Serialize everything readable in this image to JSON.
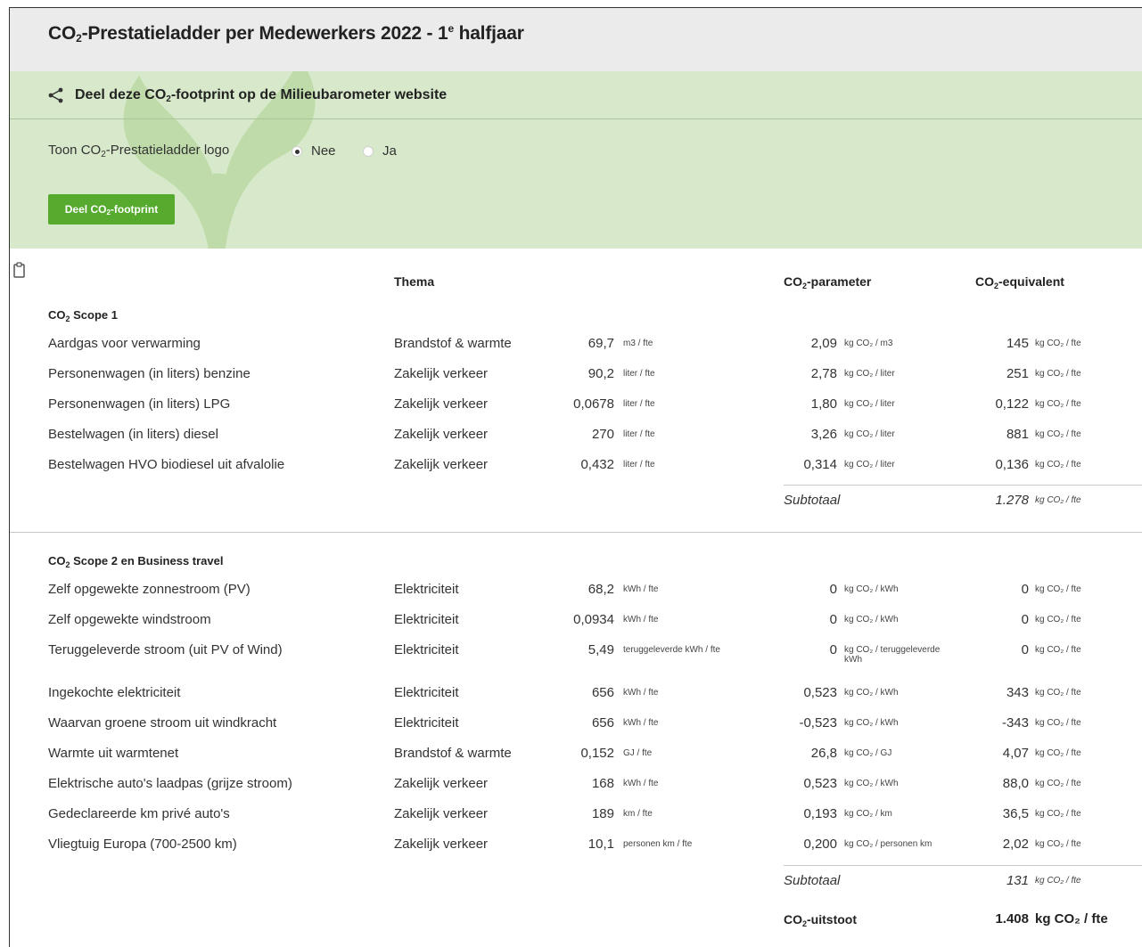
{
  "page": {
    "title_prefix": "CO",
    "title_sub": "2",
    "title_middle": "-Prestatieladder per Medewerkers 2022 - 1",
    "title_sup": "e",
    "title_suffix": " halfjaar"
  },
  "share": {
    "title_prefix": "Deel deze CO",
    "title_sub": "2",
    "title_suffix": "-footprint op de Milieubarometer website",
    "logo_label_prefix": "Toon CO",
    "logo_label_sub": "2",
    "logo_label_suffix": "-Prestatieladder logo",
    "option_no": "Nee",
    "option_yes": "Ja",
    "selected": "Nee",
    "button_prefix": "Deel CO",
    "button_sub": "2",
    "button_suffix": "-footprint",
    "button_color": "#56ab2f",
    "panel_color": "#d7e9ca"
  },
  "table": {
    "col_theme": "Thema",
    "col_param_prefix": "CO",
    "col_param_sub": "2",
    "col_param_suffix": "-parameter",
    "col_eq_prefix": "CO",
    "col_eq_sub": "2",
    "col_eq_suffix": "-equivalent"
  },
  "scope1": {
    "title_prefix": "CO",
    "title_sub": "2",
    "title_suffix": " Scope 1",
    "rows": [
      {
        "name": "Aardgas voor verwarming",
        "theme": "Brandstof & warmte",
        "amount": "69,7",
        "amount_unit": "m3 / fte",
        "param": "2,09",
        "param_unit": "kg CO₂ / m3",
        "eq": "145",
        "eq_unit": "kg CO₂ / fte"
      },
      {
        "name": "Personenwagen (in liters) benzine",
        "theme": "Zakelijk verkeer",
        "amount": "90,2",
        "amount_unit": "liter / fte",
        "param": "2,78",
        "param_unit": "kg CO₂ / liter",
        "eq": "251",
        "eq_unit": "kg CO₂ / fte"
      },
      {
        "name": "Personenwagen (in liters) LPG",
        "theme": "Zakelijk verkeer",
        "amount": "0,0678",
        "amount_unit": "liter / fte",
        "param": "1,80",
        "param_unit": "kg CO₂ / liter",
        "eq": "0,122",
        "eq_unit": "kg CO₂ / fte"
      },
      {
        "name": "Bestelwagen (in liters) diesel",
        "theme": "Zakelijk verkeer",
        "amount": "270",
        "amount_unit": "liter / fte",
        "param": "3,26",
        "param_unit": "kg CO₂ / liter",
        "eq": "881",
        "eq_unit": "kg CO₂ / fte"
      },
      {
        "name": "Bestelwagen HVO biodiesel uit afvalolie",
        "theme": "Zakelijk verkeer",
        "amount": "0,432",
        "amount_unit": "liter / fte",
        "param": "0,314",
        "param_unit": "kg CO₂ / liter",
        "eq": "0,136",
        "eq_unit": "kg CO₂ / fte"
      }
    ],
    "subtotal_label": "Subtotaal",
    "subtotal_value": "1.278",
    "subtotal_unit": "kg CO₂ / fte"
  },
  "scope2": {
    "title_prefix": "CO",
    "title_sub": "2",
    "title_suffix": " Scope 2 en Business travel",
    "rows": [
      {
        "name": "Zelf opgewekte zonnestroom (PV)",
        "theme": "Elektriciteit",
        "amount": "68,2",
        "amount_unit": "kWh / fte",
        "param": "0",
        "param_unit": "kg CO₂ / kWh",
        "eq": "0",
        "eq_unit": "kg CO₂ / fte"
      },
      {
        "name": "Zelf opgewekte windstroom",
        "theme": "Elektriciteit",
        "amount": "0,0934",
        "amount_unit": "kWh / fte",
        "param": "0",
        "param_unit": "kg CO₂ / kWh",
        "eq": "0",
        "eq_unit": "kg CO₂ / fte"
      },
      {
        "name": "Teruggeleverde stroom (uit PV of Wind)",
        "theme": "Elektriciteit",
        "amount": "5,49",
        "amount_unit": "teruggeleverde kWh / fte",
        "param": "0",
        "param_unit": "kg CO₂ / teruggeleverde kWh",
        "eq": "0",
        "eq_unit": "kg CO₂ / fte"
      },
      {
        "name": "Ingekochte elektriciteit",
        "theme": "Elektriciteit",
        "amount": "656",
        "amount_unit": "kWh / fte",
        "param": "0,523",
        "param_unit": "kg CO₂ / kWh",
        "eq": "343",
        "eq_unit": "kg CO₂ / fte"
      },
      {
        "name": "Waarvan groene stroom uit windkracht",
        "theme": "Elektriciteit",
        "amount": "656",
        "amount_unit": "kWh / fte",
        "param": "-0,523",
        "param_unit": "kg CO₂ / kWh",
        "eq": "-343",
        "eq_unit": "kg CO₂ / fte"
      },
      {
        "name": "Warmte uit warmtenet",
        "theme": "Brandstof & warmte",
        "amount": "0,152",
        "amount_unit": "GJ / fte",
        "param": "26,8",
        "param_unit": "kg CO₂ / GJ",
        "eq": "4,07",
        "eq_unit": "kg CO₂ / fte"
      },
      {
        "name": "Elektrische auto's laadpas (grijze stroom)",
        "theme": "Zakelijk verkeer",
        "amount": "168",
        "amount_unit": "kWh / fte",
        "param": "0,523",
        "param_unit": "kg CO₂ / kWh",
        "eq": "88,0",
        "eq_unit": "kg CO₂ / fte"
      },
      {
        "name": "Gedeclareerde km privé auto's",
        "theme": "Zakelijk verkeer",
        "amount": "189",
        "amount_unit": "km / fte",
        "param": "0,193",
        "param_unit": "kg CO₂ / km",
        "eq": "36,5",
        "eq_unit": "kg CO₂ / fte"
      },
      {
        "name": "Vliegtuig Europa (700-2500 km)",
        "theme": "Zakelijk verkeer",
        "amount": "10,1",
        "amount_unit": "personen km / fte",
        "param": "0,200",
        "param_unit": "kg CO₂ / personen km",
        "eq": "2,02",
        "eq_unit": "kg CO₂ / fte"
      }
    ],
    "subtotal_label": "Subtotaal",
    "subtotal_value": "131",
    "subtotal_unit": "kg CO₂ / fte"
  },
  "total": {
    "label_prefix": "CO",
    "label_sub": "2",
    "label_suffix": "-uitstoot",
    "value": "1.408",
    "unit": "kg CO₂ / fte"
  }
}
